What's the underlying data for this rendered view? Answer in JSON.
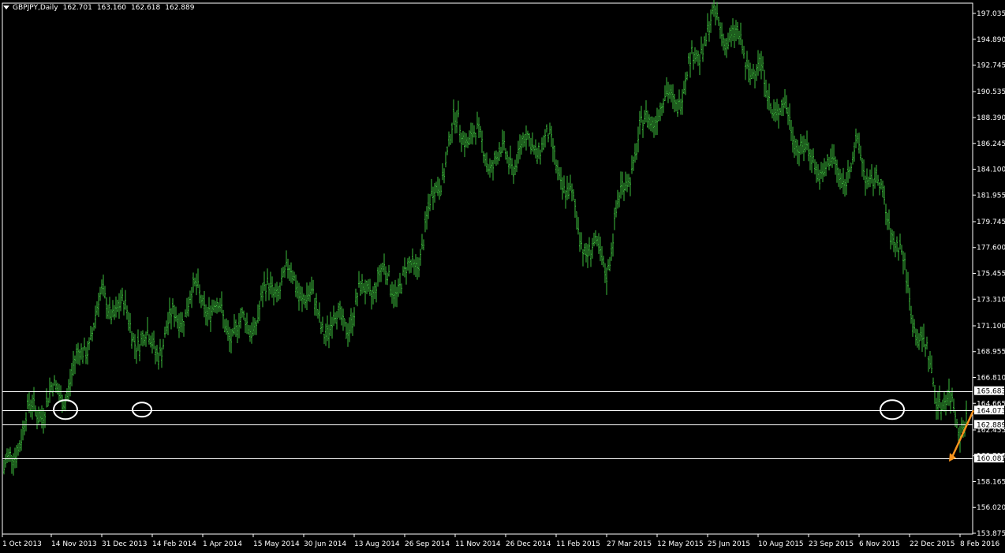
{
  "header": {
    "symbol": "GBPJPY,Daily",
    "ohlc": [
      "162.701",
      "163.160",
      "162.618",
      "162.889"
    ]
  },
  "colors": {
    "background": "#000000",
    "candle": "#3dbb3d",
    "axis": "#ffffff",
    "level_line": "#ffffff",
    "arrow": "#f7931e",
    "price_label_bg": "#ffffff",
    "price_label_text": "#000000"
  },
  "chart_data": {
    "type": "bar",
    "title": "GBPJPY,Daily",
    "y_ticks": [
      "197.035",
      "194.890",
      "192.745",
      "190.535",
      "188.390",
      "186.245",
      "184.100",
      "181.955",
      "179.745",
      "177.600",
      "175.455",
      "173.310",
      "171.100",
      "168.955",
      "166.810",
      "164.665",
      "162.455",
      "160.310",
      "158.165",
      "156.020",
      "153.875"
    ],
    "ylim": [
      153.875,
      197.035
    ],
    "x_ticks": [
      "1 Oct 2013",
      "14 Nov 2013",
      "31 Dec 2013",
      "14 Feb 2014",
      "1 Apr 2014",
      "15 May 2014",
      "30 Jun 2014",
      "13 Aug 2014",
      "26 Sep 2014",
      "11 Nov 2014",
      "26 Dec 2014",
      "11 Feb 2015",
      "27 Mar 2015",
      "12 May 2015",
      "25 Jun 2015",
      "10 Aug 2015",
      "23 Sep 2015",
      "6 Nov 2015",
      "22 Dec 2015",
      "8 Feb 2016"
    ],
    "series": [
      {
        "x": [
          "1 Oct 2013",
          "14 Nov 2013",
          "31 Dec 2013",
          "14 Feb 2014",
          "1 Apr 2014",
          "15 May 2014",
          "30 Jun 2014",
          "13 Aug 2014",
          "26 Sep 2014",
          "11 Nov 2014",
          "26 Dec 2014",
          "11 Feb 2015",
          "27 Mar 2015",
          "12 May 2015",
          "25 Jun 2015",
          "10 Aug 2015",
          "23 Sep 2015",
          "6 Nov 2015",
          "22 Dec 2015",
          "8 Feb 2016"
        ],
        "values": [
          157.5,
          166.0,
          171.5,
          171.0,
          172.0,
          172.5,
          174.0,
          171.5,
          176.0,
          186.0,
          186.5,
          184.0,
          176.5,
          190.0,
          194.5,
          194.0,
          183.0,
          186.5,
          173.0,
          162.889
        ]
      }
    ],
    "levels": [
      {
        "value": 165.683,
        "label": "165.683"
      },
      {
        "value": 164.073,
        "label": "164.073"
      },
      {
        "value": 162.889,
        "label": "162.889"
      },
      {
        "value": 160.081,
        "label": "160.081"
      }
    ],
    "annotations": {
      "circles": [
        {
          "date": "14 Nov 2013",
          "value": 164.073
        },
        {
          "date": "31 Dec 2013",
          "value": 164.073
        },
        {
          "date": "22 Dec 2015",
          "value": 164.073
        }
      ],
      "arrow": {
        "from": {
          "date": "8 Feb 2016",
          "value": 164.073
        },
        "to": {
          "date": "8 Feb 2016",
          "value": 160.081
        }
      }
    },
    "grid": false
  }
}
